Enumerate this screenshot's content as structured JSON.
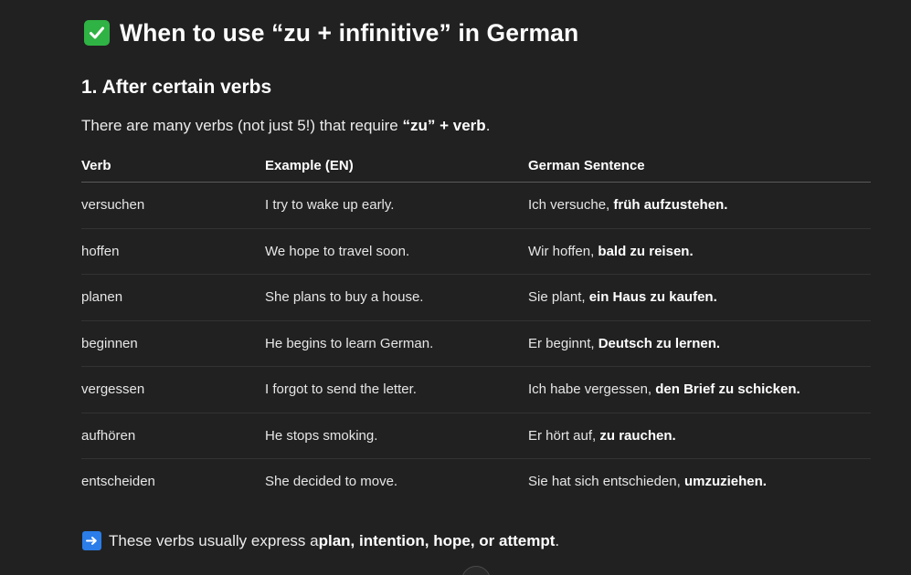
{
  "title": "When to use “zu + infinitive” in German",
  "section": {
    "heading": "1. After certain verbs",
    "intro_pre": "There are many verbs (not just 5!) that require ",
    "intro_bold_1": "“zu”",
    "intro_mid": " + ",
    "intro_bold_2": "verb",
    "intro_post": "."
  },
  "table": {
    "headers": [
      "Verb",
      "Example (EN)",
      "German Sentence"
    ],
    "rows": [
      {
        "verb": "versuchen",
        "example": "I try to wake up early.",
        "de_plain": "Ich versuche, ",
        "de_bold": "früh aufzustehen."
      },
      {
        "verb": "hoffen",
        "example": "We hope to travel soon.",
        "de_plain": "Wir hoffen, ",
        "de_bold": "bald zu reisen."
      },
      {
        "verb": "planen",
        "example": "She plans to buy a house.",
        "de_plain": "Sie plant, ",
        "de_bold": "ein Haus zu kaufen."
      },
      {
        "verb": "beginnen",
        "example": "He begins to learn German.",
        "de_plain": "Er beginnt, ",
        "de_bold": "Deutsch zu lernen."
      },
      {
        "verb": "vergessen",
        "example": "I forgot to send the letter.",
        "de_plain": "Ich habe vergessen, ",
        "de_bold": "den Brief zu schicken."
      },
      {
        "verb": "aufhören",
        "example": "He stops smoking.",
        "de_plain": "Er hört auf, ",
        "de_bold": "zu rauchen."
      },
      {
        "verb": "entscheiden",
        "example": "She decided to move.",
        "de_plain": "Sie hat sich entschieden, ",
        "de_bold": "umzuziehen."
      }
    ]
  },
  "summary": {
    "pre": "These verbs usually express a ",
    "bold": "plan, intention, hope, or attempt",
    "post": "."
  },
  "icons": {
    "title_icon": "check-mark-icon",
    "summary_icon": "right-arrow-icon"
  },
  "colors": {
    "background": "#212121",
    "check_green": "#2fb344",
    "arrow_blue": "#2b7de9"
  }
}
